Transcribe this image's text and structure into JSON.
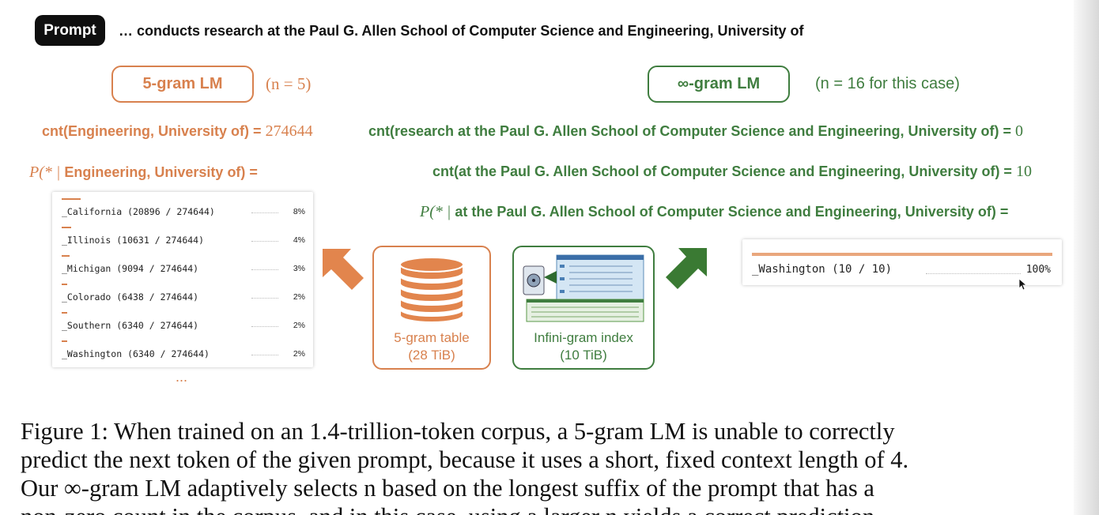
{
  "prompt": {
    "badge": "Prompt",
    "text": "… conducts research at the Paul G. Allen School of Computer Science and Engineering, University of"
  },
  "left_model": {
    "name": "5-gram LM",
    "n_note": "(n = 5)",
    "count_label": "cnt(Engineering, University of) =",
    "count_value": "274644",
    "prob_prefix": "P(* |",
    "prob_label": "Engineering, University of) =",
    "distribution": [
      {
        "label": "_California (20896 / 274644)",
        "pct": "8%",
        "fraction": 0.076
      },
      {
        "label": "_Illinois (10631 / 274644)",
        "pct": "4%",
        "fraction": 0.039
      },
      {
        "label": "_Michigan (9094 / 274644)",
        "pct": "3%",
        "fraction": 0.033
      },
      {
        "label": "_Colorado (6438 / 274644)",
        "pct": "2%",
        "fraction": 0.023
      },
      {
        "label": "_Southern (6340 / 274644)",
        "pct": "2%",
        "fraction": 0.023
      },
      {
        "label": "_Washington (6340 / 274644)",
        "pct": "2%",
        "fraction": 0.023
      }
    ],
    "ellipsis": "...",
    "store_label": "5-gram table",
    "store_size": "(28 TiB)"
  },
  "right_model": {
    "name": "∞-gram LM",
    "n_note": "(n = 16 for this case)",
    "count1_label": "cnt(research at the Paul G. Allen School of Computer Science and Engineering, University of) =",
    "count1_value": "0",
    "count2_label": "cnt(at the Paul G. Allen School of Computer Science and Engineering, University of) =",
    "count2_value": "10",
    "prob_prefix": "P(* |",
    "prob_label": "at the Paul G. Allen School of Computer Science and Engineering, University of) =",
    "distribution": [
      {
        "label": "_Washington (10 / 10)",
        "pct": "100%",
        "fraction": 1.0
      }
    ],
    "store_label": "Infini-gram index",
    "store_size": "(10 TiB)"
  },
  "caption_lines": [
    "Figure 1: When trained on an 1.4-trillion-token corpus, a 5-gram LM is unable to correctly",
    "predict the next token of the given prompt, because it uses a short, fixed context length of 4.",
    "Our ∞-gram LM adaptively selects n based on the longest suffix of the prompt that has a",
    "non-zero count in the corpus, and in this case, using a larger n yields a correct prediction."
  ],
  "colors": {
    "orange": "#d8814e",
    "green": "#3f7d3f"
  }
}
